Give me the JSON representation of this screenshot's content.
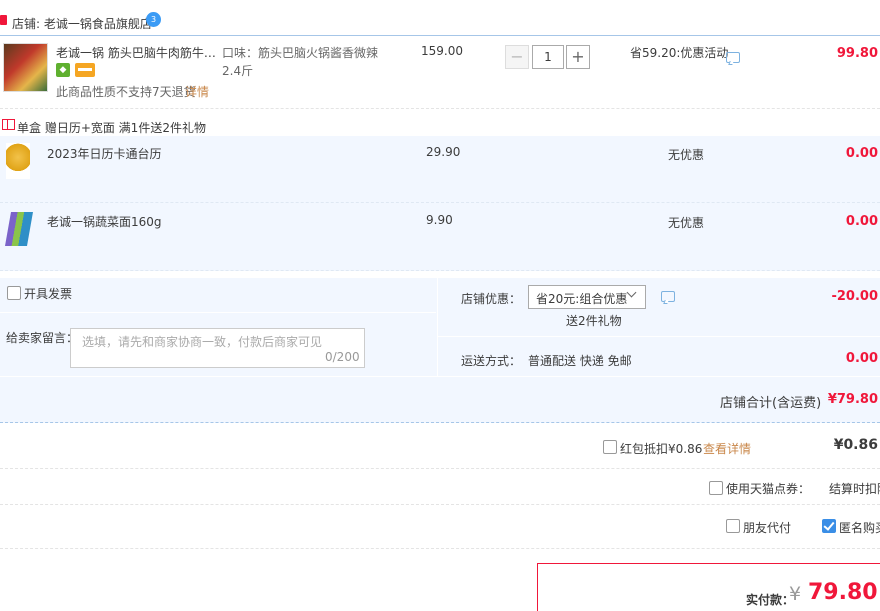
{
  "shop": {
    "label": "店铺: 老诚一锅食品旗舰店",
    "wangwang_badge": "3"
  },
  "item": {
    "title": "老诚一锅 筋头巴脑牛肉筋牛蹄...",
    "sku": "口味：筋头巴脑火锅酱香微辣2.4斤",
    "price": "159.00",
    "quantity": "1",
    "minus_label": "−",
    "plus_label": "+",
    "promo": "省59.20:优惠活动",
    "subtotal": "99.80",
    "no_return_note": "此商品性质不支持7天退货",
    "detail_link": "详情"
  },
  "gift_group": {
    "title": "单盒 赠日历+宽面    满1件送2件礼物",
    "gifts": [
      {
        "name": "2023年日历卡通台历",
        "price": "29.90",
        "promo": "无优惠",
        "subtotal": "0.00"
      },
      {
        "name": "老诚一锅蔬菜面160g",
        "price": "9.90",
        "promo": "无优惠",
        "subtotal": "0.00"
      }
    ]
  },
  "order_options": {
    "invoice_label": "开具发票",
    "message_label": "给卖家留言：",
    "message_placeholder": "选填，请先和商家协商一致，付款后商家可见",
    "message_count": "0/200",
    "shop_discount_label": "店铺优惠：",
    "shop_discount_value": "省20元:组合优惠",
    "shop_discount_note": "送2件礼物",
    "shop_discount_amount": "-20.00",
    "shipping_label": "运送方式：",
    "shipping_value": "普通配送 快递 免邮",
    "shipping_amount": "0.00",
    "shop_total_label": "店铺合计(含运费)",
    "shop_total_value": "¥79.80"
  },
  "redpacket": {
    "label": "红包抵扣¥0.86",
    "link": "查看详情",
    "amount": "¥0.86"
  },
  "tmall_points": {
    "label": "使用天猫点券：",
    "note": "结算时扣除"
  },
  "friend_pay": {
    "label": "朋友代付"
  },
  "anonymous": {
    "label": "匿名购买"
  },
  "payment": {
    "label": "实付款：",
    "currency": "¥",
    "amount": "79.80"
  },
  "colors": {
    "accent": "#f0173a",
    "link": "#c9874a",
    "band": "#f2f7ff"
  }
}
